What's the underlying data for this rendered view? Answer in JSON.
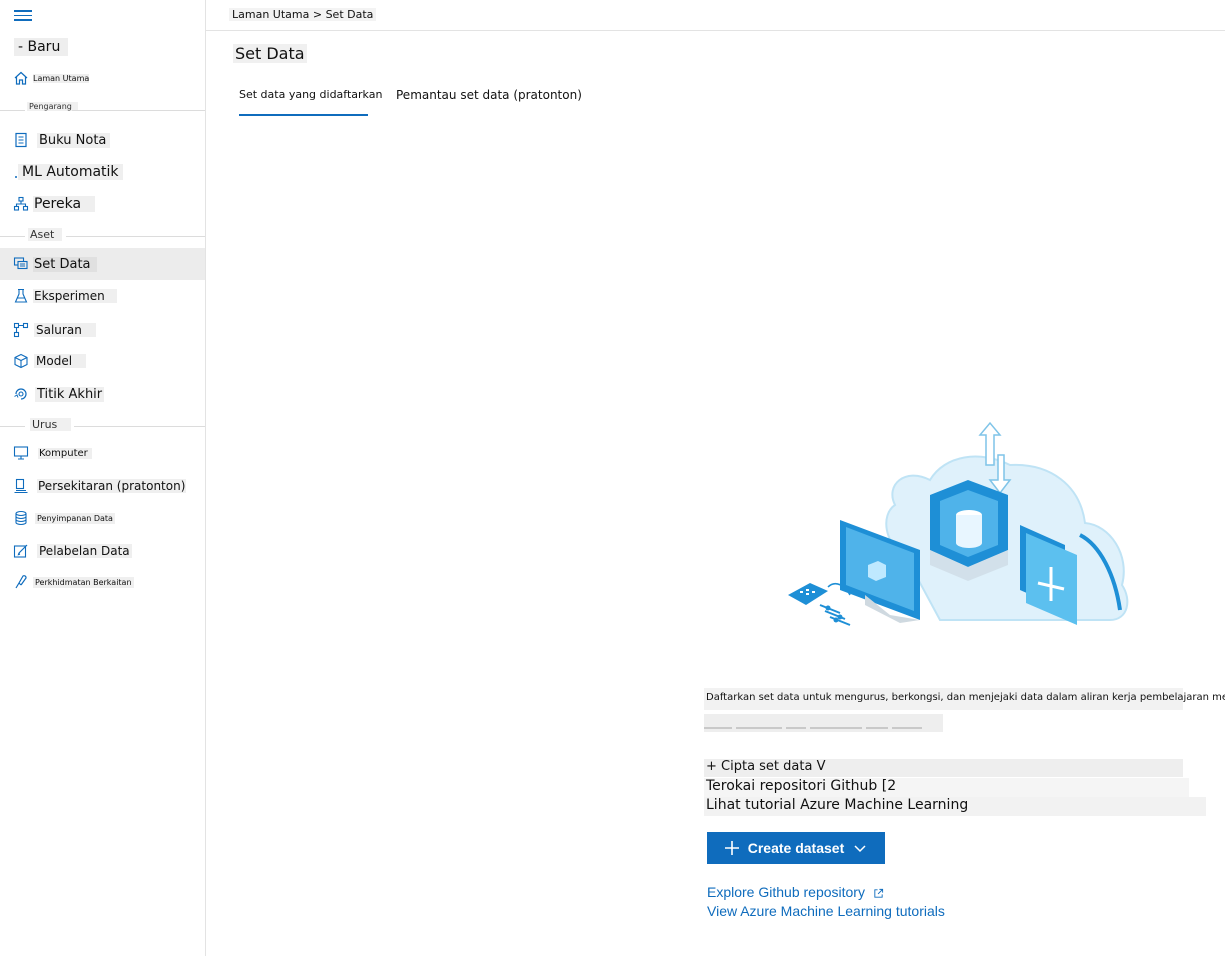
{
  "sidebar": {
    "new_label": "- Baru",
    "home": "Laman Utama",
    "sections": {
      "author": "Pengarang",
      "assets": "Aset",
      "manage": "Urus"
    },
    "items": [
      {
        "label": "Buku Nota",
        "icon": "notebook-icon"
      },
      {
        "label": "ML Automatik",
        "icon": "automl-icon"
      },
      {
        "label": "Pereka",
        "icon": "designer-icon"
      },
      {
        "label": "Set Data",
        "icon": "dataset-icon"
      },
      {
        "label": "Eksperimen",
        "icon": "flask-icon"
      },
      {
        "label": "Saluran",
        "icon": "pipeline-icon"
      },
      {
        "label": "Model",
        "icon": "cube-icon"
      },
      {
        "label": "Titik Akhir",
        "icon": "endpoint-icon"
      },
      {
        "label": "Komputer",
        "icon": "monitor-icon"
      },
      {
        "label": "Persekitaran (pratonton)",
        "icon": "environment-icon"
      },
      {
        "label": "Penyimpanan Data",
        "icon": "database-icon"
      },
      {
        "label": "Pelabelan Data",
        "icon": "edit-icon"
      },
      {
        "label": "Perkhidmatan Berkaitan",
        "icon": "link-icon"
      }
    ]
  },
  "header": {
    "breadcrumb": "Laman Utama > Set Data"
  },
  "main": {
    "title": "Set Data",
    "tabs": [
      "Set data yang didaftarkan",
      "Pemantau set data (pratonton)"
    ],
    "empty_state": {
      "description": "Daftarkan set data untuk mengurus, berkongsi, dan menjejaki data dalam aliran kerja pembelajaran mesin anda.",
      "translated_button": "+ Cipta set data V",
      "translated_link1": "Terokai repositori Github [2",
      "translated_link2": "Lihat tutorial Azure Machine Learning",
      "create_button": "Create dataset",
      "link_github": "Explore Github repository",
      "link_tutorials": "View Azure Machine Learning tutorials"
    }
  },
  "colors": {
    "accent": "#0f6cbd",
    "active_bg": "#ececec"
  }
}
